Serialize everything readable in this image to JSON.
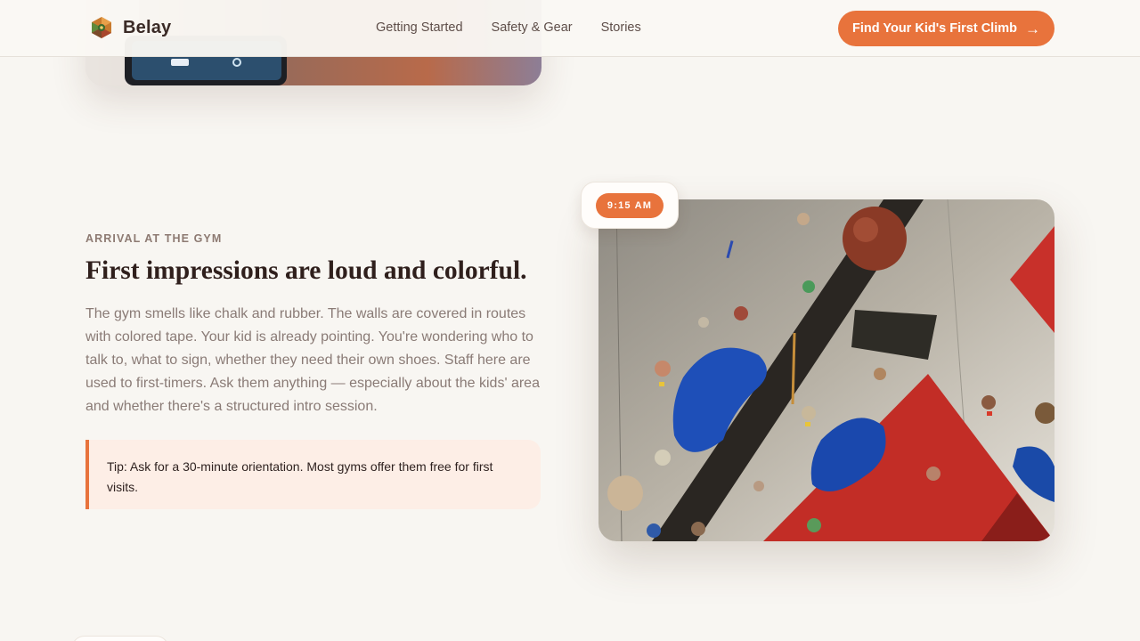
{
  "header": {
    "brand_name": "Belay",
    "brand_icon": "hexagon-logo-icon",
    "nav": [
      {
        "label": "Getting Started"
      },
      {
        "label": "Safety & Gear"
      },
      {
        "label": "Stories"
      }
    ],
    "cta_label": "Find Your Kid's First Climb",
    "cta_icon": "arrow-right-icon"
  },
  "section": {
    "eyebrow": "ARRIVAL AT THE GYM",
    "heading": "First impressions are loud and colorful.",
    "body": "The gym smells like chalk and rubber. The walls are covered in routes with colored tape. Your kid is already pointing. You're wondering who to talk to, what to sign, whether they need their own shoes. Staff here are used to first-timers. Ask them anything — especially about the kids' area and whether there's a structured intro session.",
    "tip": "Tip: Ask for a 30-minute orientation. Most gyms offer them free for first visits.",
    "time": "9:15 AM"
  },
  "colors": {
    "accent": "#e8733c",
    "background": "#f8f6f2",
    "tip_background": "#fdeee6",
    "heading": "#2f1f1c",
    "body_text": "#8a7b76"
  }
}
